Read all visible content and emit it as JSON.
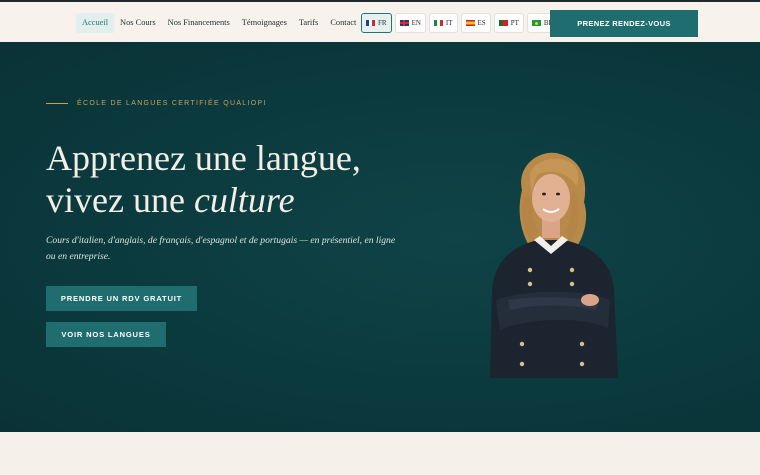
{
  "nav": {
    "items": [
      {
        "label": "Accueil",
        "active": true
      },
      {
        "label": "Nos Cours",
        "active": false
      },
      {
        "label": "Nos Financements",
        "active": false
      },
      {
        "label": "Témoignages",
        "active": false
      },
      {
        "label": "Tarifs",
        "active": false
      },
      {
        "label": "Contact",
        "active": false
      }
    ]
  },
  "languages": [
    {
      "code": "FR",
      "flag": "fr-flag-icon",
      "active": true
    },
    {
      "code": "EN",
      "flag": "uk-flag-icon",
      "active": false
    },
    {
      "code": "IT",
      "flag": "it-flag-icon",
      "active": false
    },
    {
      "code": "ES",
      "flag": "es-flag-icon",
      "active": false
    },
    {
      "code": "PT",
      "flag": "pt-flag-icon",
      "active": false
    },
    {
      "code": "BR",
      "flag": "br-flag-icon",
      "active": false
    }
  ],
  "header_cta": "PRENEZ RENDEZ-VOUS",
  "hero": {
    "eyebrow": "ÉCOLE DE LANGUES CERTIFIÉE QUALIOPI",
    "headline_line1": "Apprenez une langue,",
    "headline_line2_prefix": "vivez une ",
    "headline_line2_em": "culture",
    "subtitle": "Cours d'italien, d'anglais, de français, d'espagnol et de portugais — en présentiel, en ligne ou en entreprise.",
    "primary_button": "PRENDRE UN RDV GRATUIT",
    "secondary_button": "VOIR NOS LANGUES"
  },
  "colors": {
    "hero_bg": "#0b3a3e",
    "accent": "#1f6d6e",
    "gold": "#c8a258",
    "cream": "#f5f1ea"
  }
}
